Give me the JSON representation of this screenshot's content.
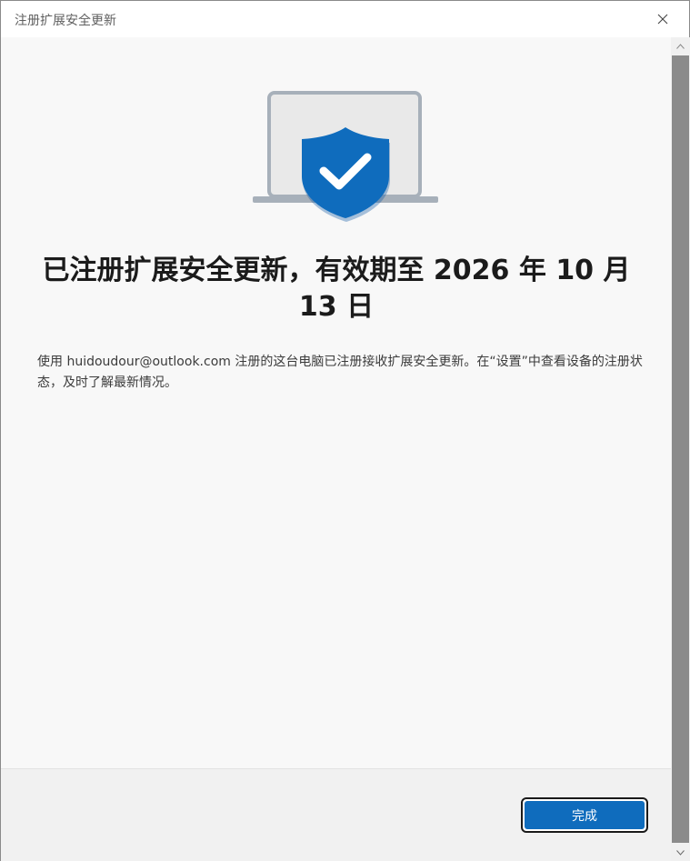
{
  "window": {
    "title": "注册扩展安全更新",
    "close_icon": "close-icon"
  },
  "content": {
    "hero_icon": "shield-check-laptop-icon",
    "headline": "已注册扩展安全更新，有效期至 2026 年 10 月 13 日",
    "body": "使用 huidoudour@outlook.com 注册的这台电脑已注册接收扩展安全更新。在“设置”中查看设备的注册状态，及时了解最新情况。"
  },
  "footer": {
    "done_label": "完成"
  },
  "colors": {
    "accent": "#0f6cbd",
    "shield": "#0f6cbd",
    "background": "#f8f8f8"
  }
}
